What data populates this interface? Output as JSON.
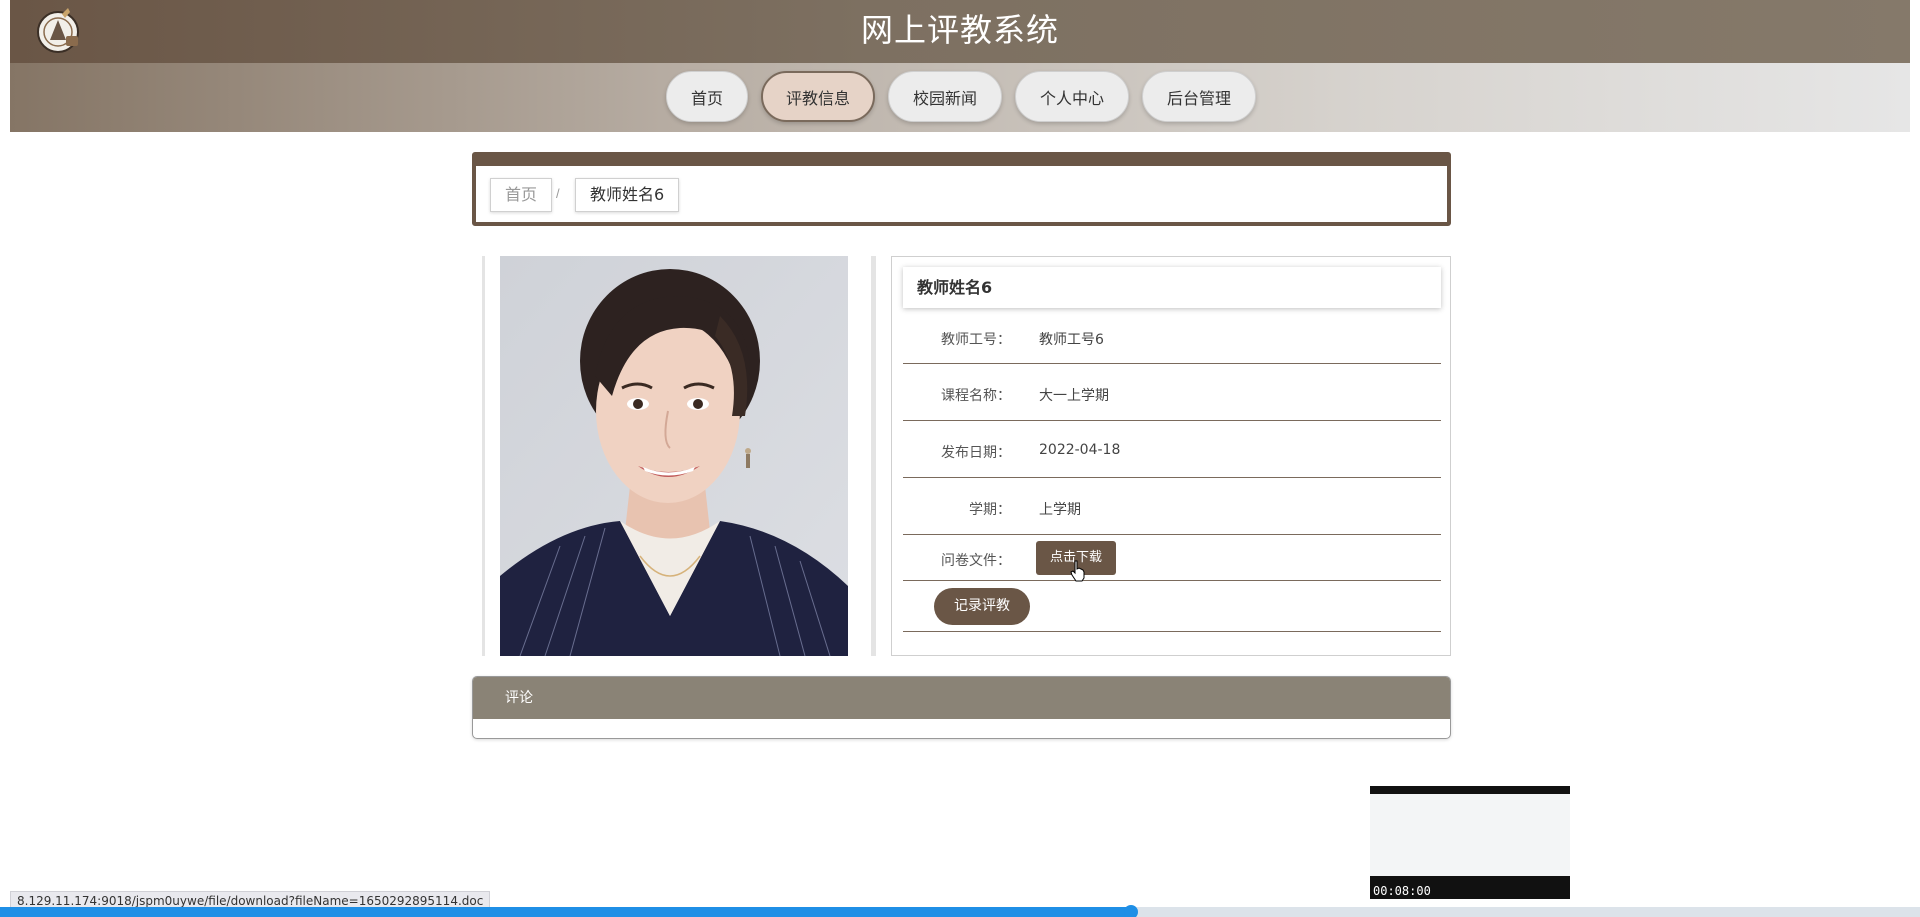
{
  "header": {
    "title": "网上评教系统",
    "logo_icon": "seal-logo-icon"
  },
  "nav": {
    "items": [
      {
        "label": "首页",
        "active": false
      },
      {
        "label": "评教信息",
        "active": true
      },
      {
        "label": "校园新闻",
        "active": false
      },
      {
        "label": "个人中心",
        "active": false
      },
      {
        "label": "后台管理",
        "active": false
      }
    ]
  },
  "breadcrumb": {
    "home": "首页",
    "separator": "/",
    "current": "教师姓名6"
  },
  "detail": {
    "title": "教师姓名6",
    "fields": [
      {
        "label": "教师工号：",
        "value": "教师工号6"
      },
      {
        "label": "课程名称：",
        "value": "大一上学期"
      },
      {
        "label": "发布日期：",
        "value": "2022-04-18"
      },
      {
        "label": "学期：",
        "value": "上学期"
      },
      {
        "label": "问卷文件：",
        "value": ""
      }
    ],
    "download_button": "点击下载",
    "rate_button": "记录评教"
  },
  "comments": {
    "title": "评论"
  },
  "status_url": "8.129.11.174:9018/jspm0uywe/file/download?fileName=1650292895114.doc",
  "video": {
    "timestamp": "00:08:00",
    "progress": 0.589
  },
  "colors": {
    "brand": "#6a5646",
    "nav_active": "#e6d3c7",
    "comment_head": "#8a8376",
    "progress": "#1f8fe6"
  }
}
